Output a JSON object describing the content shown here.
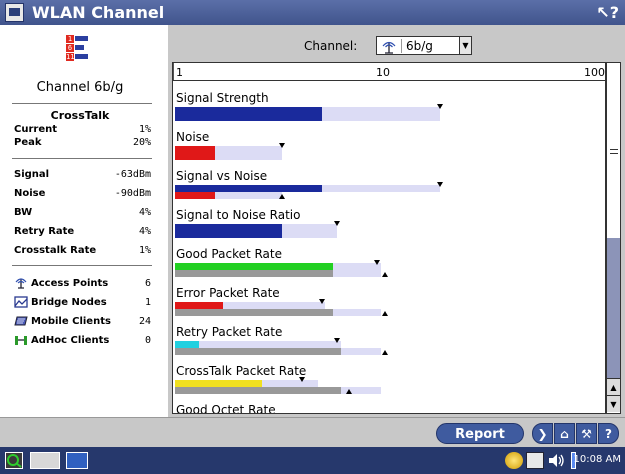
{
  "window": {
    "title": "WLAN Channel"
  },
  "left_panel": {
    "channel_title": "Channel 6b/g",
    "crosstalk": {
      "title": "CrossTalk",
      "rows": [
        {
          "label": "Current",
          "value": "1%"
        },
        {
          "label": "Peak",
          "value": "20%"
        }
      ]
    },
    "stats": [
      {
        "label": "Signal",
        "value": "-63dBm"
      },
      {
        "label": "Noise",
        "value": "-90dBm"
      },
      {
        "label": "BW",
        "value": "4%"
      },
      {
        "label": "Retry Rate",
        "value": "4%"
      },
      {
        "label": "Crosstalk Rate",
        "value": "1%"
      }
    ],
    "network": [
      {
        "label": "Access Points",
        "value": "6",
        "icon": "antenna-icon"
      },
      {
        "label": "Bridge Nodes",
        "value": "1",
        "icon": "bridge-icon"
      },
      {
        "label": "Mobile Clients",
        "value": "24",
        "icon": "mobile-client-icon"
      },
      {
        "label": "AdHoc Clients",
        "value": "0",
        "icon": "adhoc-icon"
      }
    ]
  },
  "channel_selector": {
    "label": "Channel:",
    "value": "6b/g"
  },
  "scale": {
    "ticks": [
      "1",
      "10",
      "100"
    ]
  },
  "metrics": [
    {
      "label": "Signal Strength",
      "style": "single",
      "color": "#1a2a9c",
      "value": 0.37,
      "range": 0.67,
      "marker_down": 0.67
    },
    {
      "label": "Noise",
      "style": "single",
      "color": "#e01818",
      "value": 0.1,
      "range": 0.27,
      "marker_down": 0.27
    },
    {
      "label": "Signal vs Noise",
      "style": "dual",
      "colors": [
        "#1a2a9c",
        "#e01818"
      ],
      "values": [
        0.37,
        0.1
      ],
      "ranges": [
        0.67,
        0.27
      ],
      "marker_down": 0.67,
      "marker_up": 0.27
    },
    {
      "label": "Signal to Noise Ratio",
      "style": "single",
      "color": "#1a2a9c",
      "value": 0.27,
      "range": 0.41,
      "marker_down": 0.41
    },
    {
      "label": "Good Packet Rate",
      "style": "dual",
      "colors": [
        "#22d022",
        "#999999"
      ],
      "values": [
        0.4,
        0.4
      ],
      "ranges": [
        0.52,
        0.52
      ],
      "marker_down": 0.51,
      "marker_up": 0.53
    },
    {
      "label": "Error Packet Rate",
      "style": "dual",
      "colors": [
        "#e01818",
        "#999999"
      ],
      "values": [
        0.12,
        0.4
      ],
      "ranges": [
        0.38,
        0.52
      ],
      "marker_down": 0.37,
      "marker_up": 0.53
    },
    {
      "label": "Retry Packet Rate",
      "style": "dual",
      "colors": [
        "#22d0e0",
        "#999999"
      ],
      "values": [
        0.06,
        0.42
      ],
      "ranges": [
        0.42,
        0.52
      ],
      "marker_down": 0.41,
      "marker_up": 0.53
    },
    {
      "label": "CrossTalk Packet Rate",
      "style": "dual",
      "colors": [
        "#f0e020",
        "#999999"
      ],
      "values": [
        0.22,
        0.42
      ],
      "ranges": [
        0.36,
        0.52
      ],
      "marker_down": 0.32,
      "marker_up": 0.44
    },
    {
      "label": "Good Octet Rate",
      "style": "single",
      "color": "#22d022",
      "value": 0.0,
      "range": 0.0,
      "marker_down": null
    }
  ],
  "toolbar": {
    "report_label": "Report"
  },
  "taskbar": {
    "clock": "10:08 AM"
  }
}
